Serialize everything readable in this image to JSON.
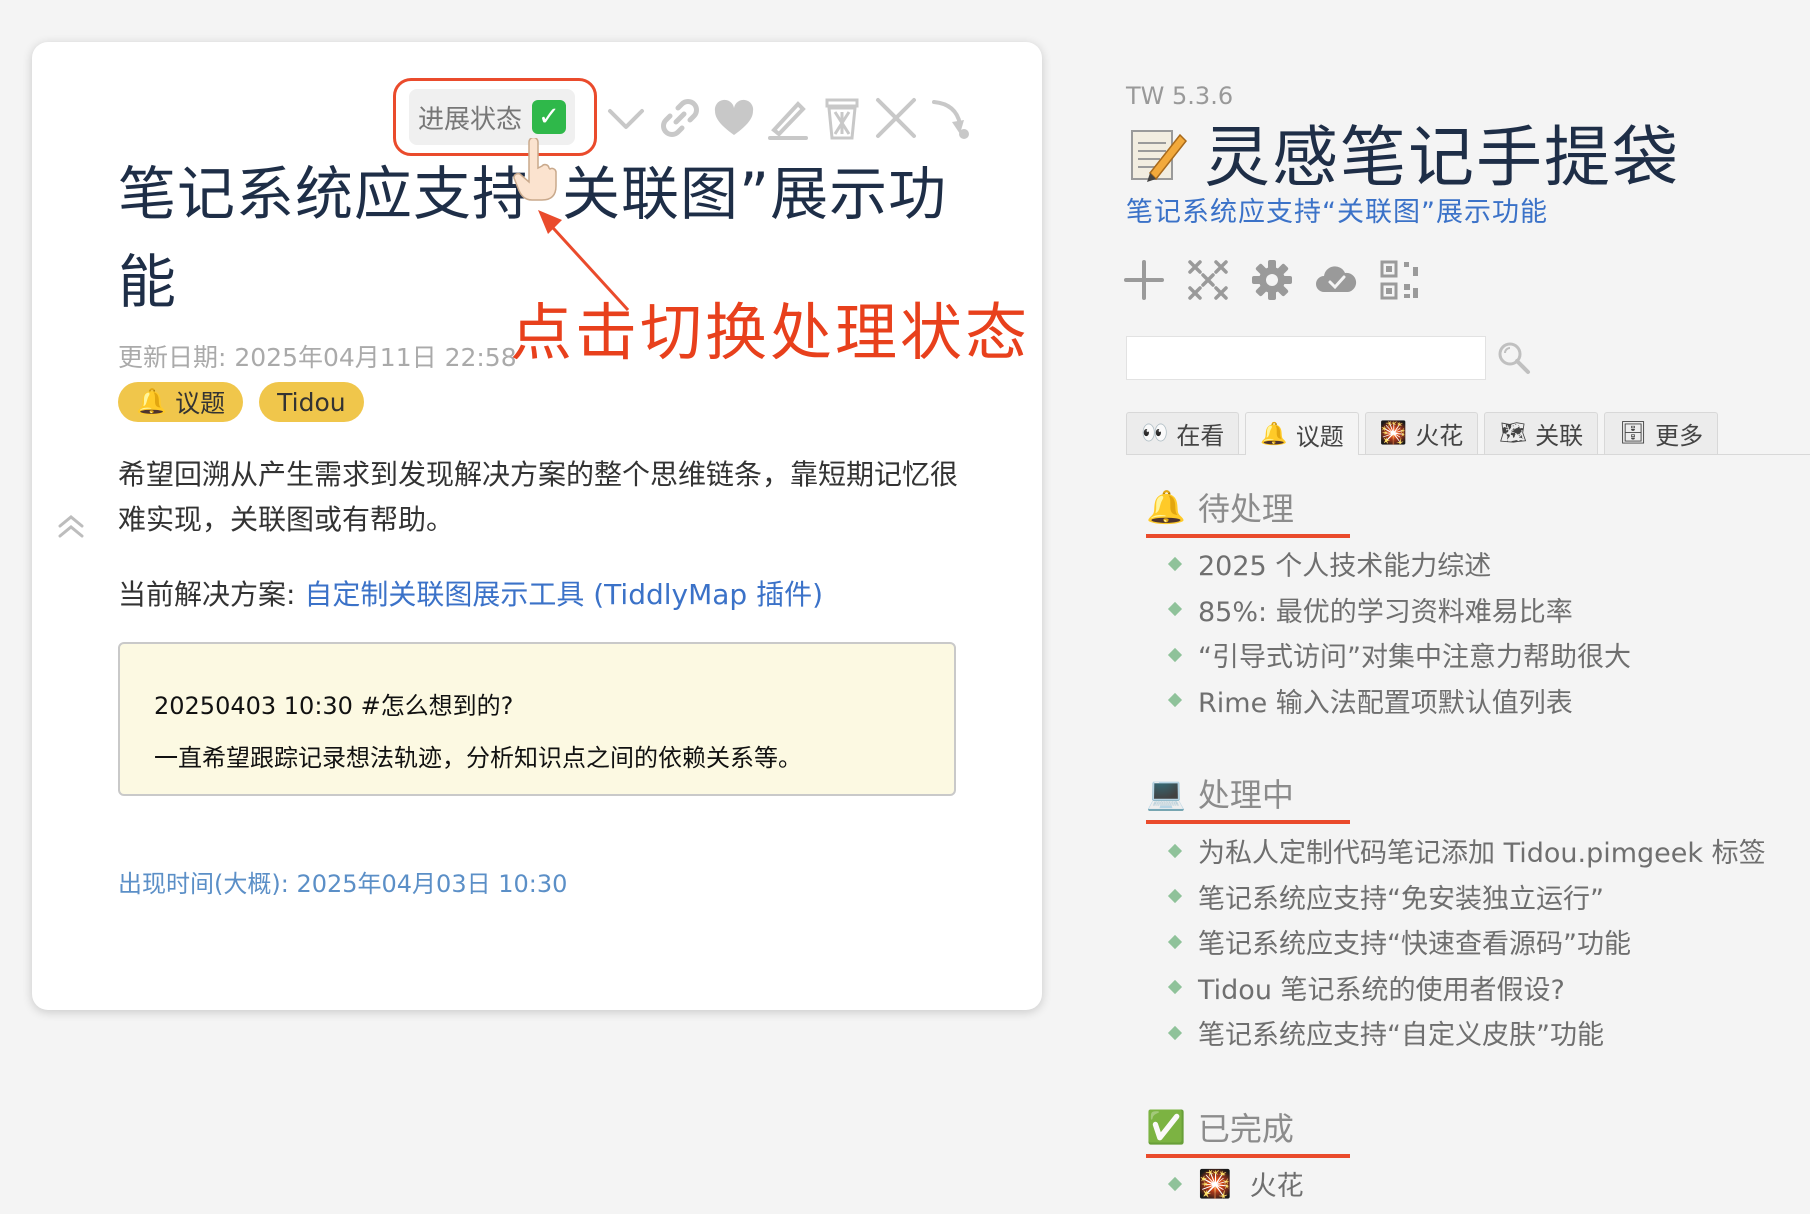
{
  "tiddler": {
    "status_button": {
      "label": "进展状态",
      "icon": "✓"
    },
    "toolbar": [
      "chevron-down-icon",
      "link-icon",
      "heart-icon",
      "edit-pencil-icon",
      "trash-icon",
      "close-icon",
      "fold-arrow-icon"
    ],
    "title_line1": "笔记系统应支持“关联图”展示功",
    "title_line2": "能",
    "annotation": "点击切换处理状态",
    "modified": "更新日期: 2025年04月11日 22:58",
    "tags": [
      {
        "emoji": "🔔",
        "label": "议题"
      },
      {
        "label": "Tidou"
      }
    ],
    "body": "希望回溯从产生需求到发现解决方案的整个思维链条，靠短期记忆很难实现，关联图或有帮助。",
    "solution_prefix": "当前解决方案: ",
    "solution_link": "自定制关联图展示工具 (TiddlyMap 插件)",
    "note_line1": "20250403 10:30 #怎么想到的?",
    "note_line2": "一直希望跟踪记录想法轨迹，分析知识点之间的依赖关系等。",
    "appear_time": "出现时间(大概): 2025年04月03日 10:30"
  },
  "sidebar": {
    "version": "TW 5.3.6",
    "title": "灵感笔记手提袋",
    "subtitle": "笔记系统应支持“关联图”展示功能",
    "page_tools": [
      "plus-icon",
      "grid-icon",
      "gear-icon",
      "cloud-icon",
      "qr-code-icon"
    ],
    "search": {
      "value": "",
      "placeholder": ""
    },
    "tabs": [
      {
        "emoji": "👀",
        "label": "在看"
      },
      {
        "emoji": "🔔",
        "label": "议题",
        "active": true
      },
      {
        "emoji": "🎇",
        "label": "火花"
      },
      {
        "emoji": "🗺",
        "label": "关联"
      },
      {
        "emoji": "🗄",
        "label": "更多"
      }
    ],
    "sections": [
      {
        "emoji": "🔔",
        "heading": "待处理",
        "items": [
          "2025 个人技术能力综述",
          "85%: 最优的学习资料难易比率",
          "“引导式访问”对集中注意力帮助很大",
          "Rime 输入法配置项默认值列表"
        ]
      },
      {
        "emoji": "💻",
        "heading": "处理中",
        "items": [
          "为私人定制代码笔记添加 Tidou.pimgeek 标签",
          "笔记系统应支持“免安装独立运行”",
          "笔记系统应支持“快速查看源码”功能",
          "Tidou 笔记系统的使用者假设?",
          "笔记系统应支持“自定义皮肤”功能"
        ]
      },
      {
        "emoji": "✅",
        "heading": "已完成",
        "items": [
          "火花"
        ],
        "item_emoji": "🎇"
      }
    ]
  },
  "colors": {
    "accent": "#ea4b2c",
    "link": "#3b72c8",
    "tag": "#f0c64b",
    "title": "#1e2e47",
    "check": "#2fb84a"
  }
}
